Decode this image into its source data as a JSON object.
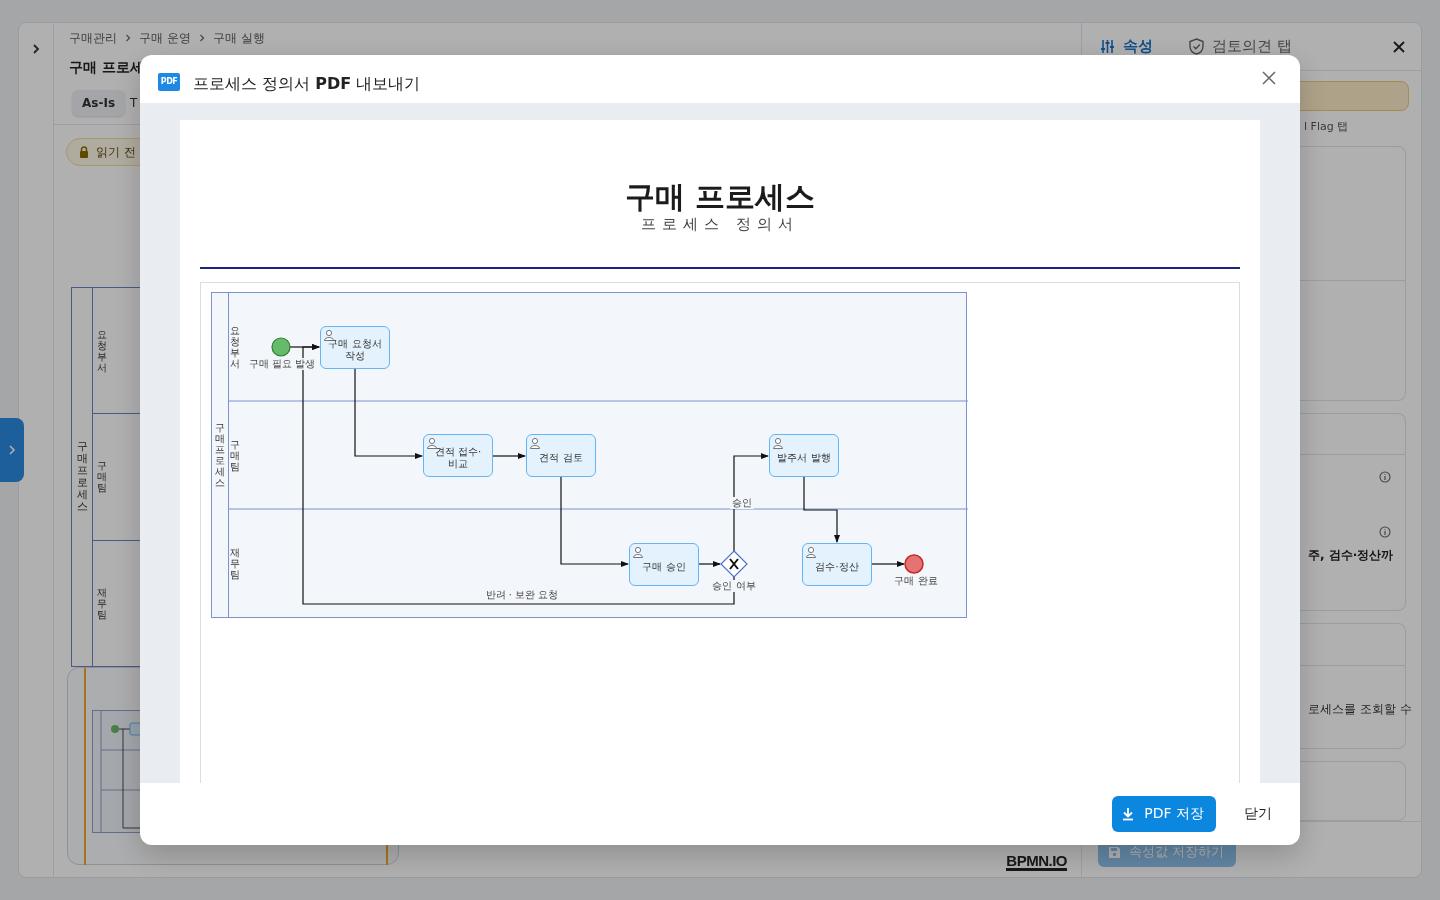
{
  "breadcrumbs": [
    "구매관리",
    "구매 운영",
    "구매 실행"
  ],
  "page_title": "구매 프로세",
  "view_tabs": [
    {
      "label": "As-Is",
      "selected": true
    },
    {
      "label": "T",
      "selected": false
    }
  ],
  "read_only_badge": "읽기 전",
  "canvas": {
    "pool": "구매프로세스",
    "lanes": [
      "요청 부서",
      "구매팀",
      "재무팀"
    ],
    "logo": "BPMN.IO"
  },
  "side_panel": {
    "tabs": [
      {
        "label": "속성",
        "selected": true
      },
      {
        "label": "검토의견 탭",
        "selected": false
      }
    ],
    "flag_tab": "l Flag 탭",
    "description_fragment": "주, 검수·정산까",
    "scope_fragment": "로세스를 조회할 수",
    "save_button": "속성값 저장하기"
  },
  "modal": {
    "badge": "PDF",
    "title": "프로세스 정의서 **PDF** 내보내기",
    "document": {
      "title": "구매 프로세스",
      "subtitle": "프로세스 정의서",
      "diagram": {
        "pool": "구매 프로세스",
        "lanes": [
          "요청 부서",
          "구매팀",
          "재무팀"
        ],
        "nodes": [
          {
            "kind": "start",
            "label": "구매 필요 발생"
          },
          {
            "kind": "task",
            "label": "구매 요청서 작성"
          },
          {
            "kind": "task",
            "label": "견적 접수·비교"
          },
          {
            "kind": "task",
            "label": "견적 검토"
          },
          {
            "kind": "task",
            "label": "구매 승인"
          },
          {
            "kind": "gateway",
            "label": "승인 여부"
          },
          {
            "kind": "task",
            "label": "발주서 발행"
          },
          {
            "kind": "task",
            "label": "검수·정산"
          },
          {
            "kind": "end",
            "label": "구매 완료"
          }
        ],
        "flow_labels": [
          "승인",
          "반려 · 보완 요청"
        ]
      }
    },
    "buttons": [
      {
        "label": "PDF 저장",
        "kind": "primary"
      },
      {
        "label": "닫기",
        "kind": "plain"
      }
    ]
  }
}
